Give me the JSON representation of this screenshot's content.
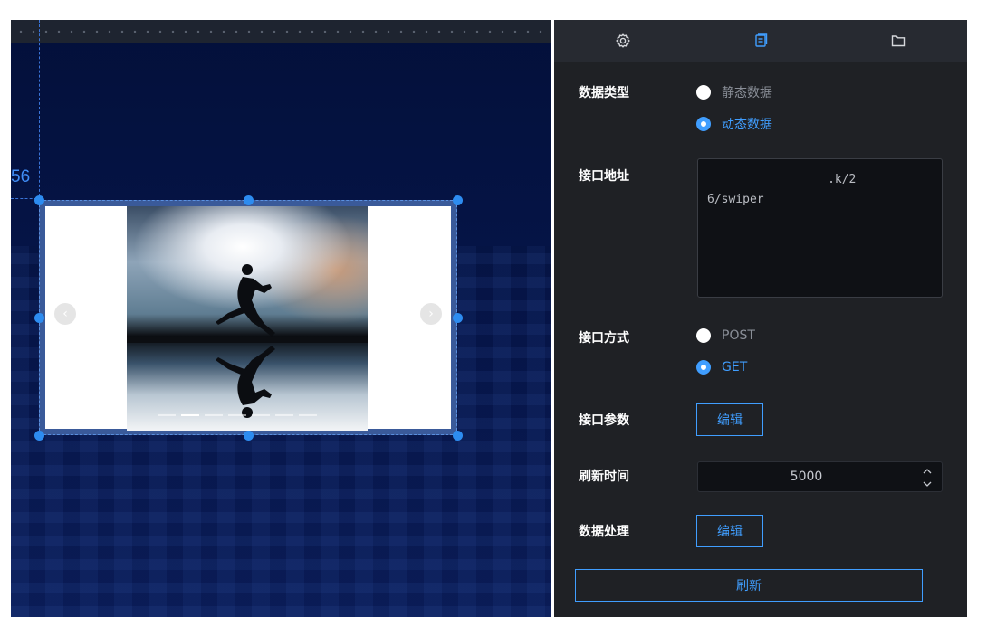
{
  "canvas": {
    "coord_label": "56"
  },
  "swiper": {
    "prev_glyph": "‹",
    "next_glyph": "›"
  },
  "panel": {
    "tabs": [
      {
        "icon": "gear-icon"
      },
      {
        "icon": "data-icon"
      },
      {
        "icon": "folder-icon"
      }
    ],
    "data_type": {
      "label": "数据类型",
      "options": [
        "静态数据",
        "动态数据"
      ],
      "selected": "动态数据"
    },
    "api_url": {
      "label": "接口地址",
      "value": "                 .k/2\n6/swiper"
    },
    "api_method": {
      "label": "接口方式",
      "options": [
        "POST",
        "GET"
      ],
      "selected": "GET"
    },
    "api_params": {
      "label": "接口参数",
      "button": "编辑"
    },
    "refresh_time": {
      "label": "刷新时间",
      "value": "5000"
    },
    "data_processing": {
      "label": "数据处理",
      "button": "编辑"
    },
    "refresh_button": "刷新"
  },
  "colors": {
    "accent": "#409eff",
    "panel_bg": "#1f2125",
    "canvas_bg": "#06154a"
  }
}
